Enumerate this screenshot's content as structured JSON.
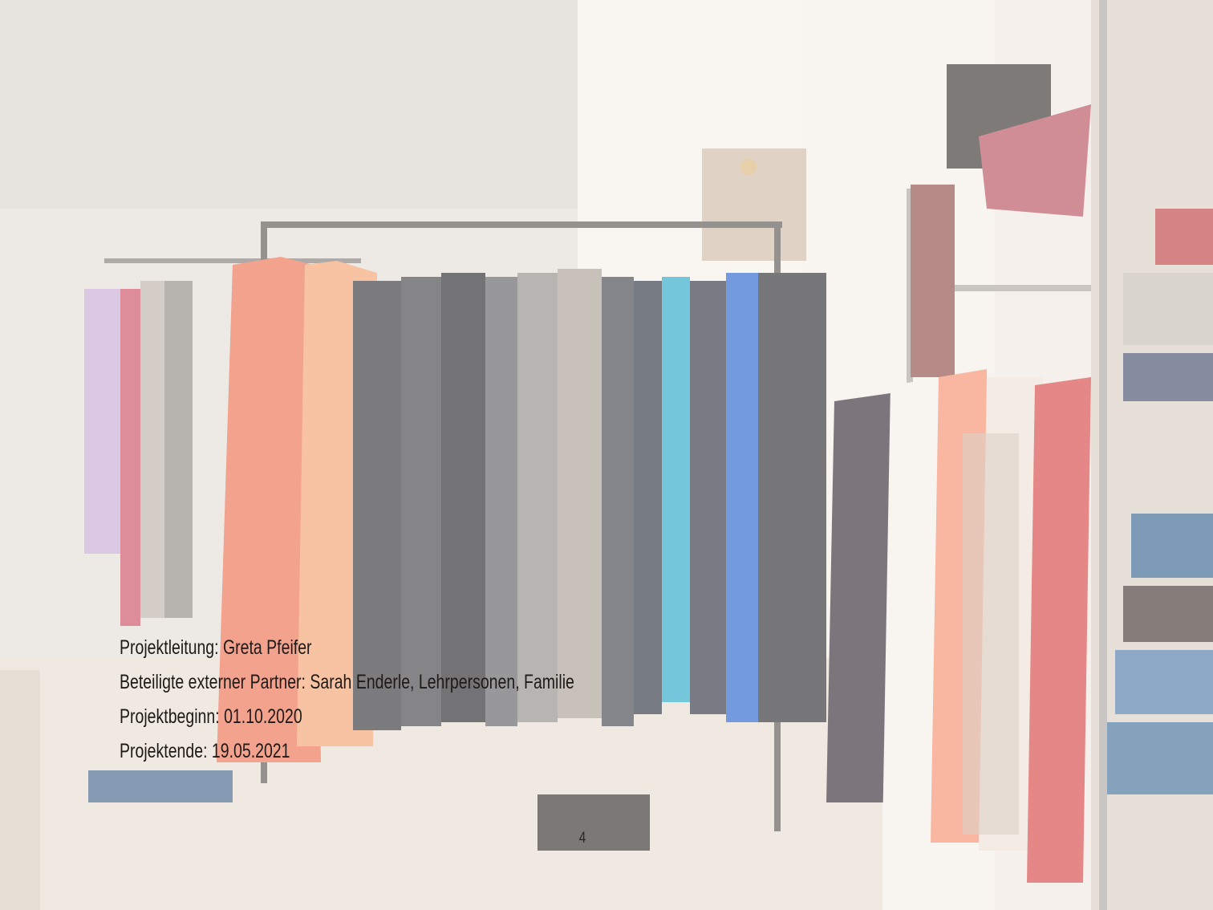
{
  "project_info": {
    "lead": "Projektleitung: Greta Pfeifer",
    "partners": "Beteiligte externer Partner: Sarah Enderle, Lehrpersonen, Familie",
    "start": "Projektbeginn: 01.10.2020",
    "end": "Projektende: 19.05.2021"
  },
  "page_number": "4"
}
